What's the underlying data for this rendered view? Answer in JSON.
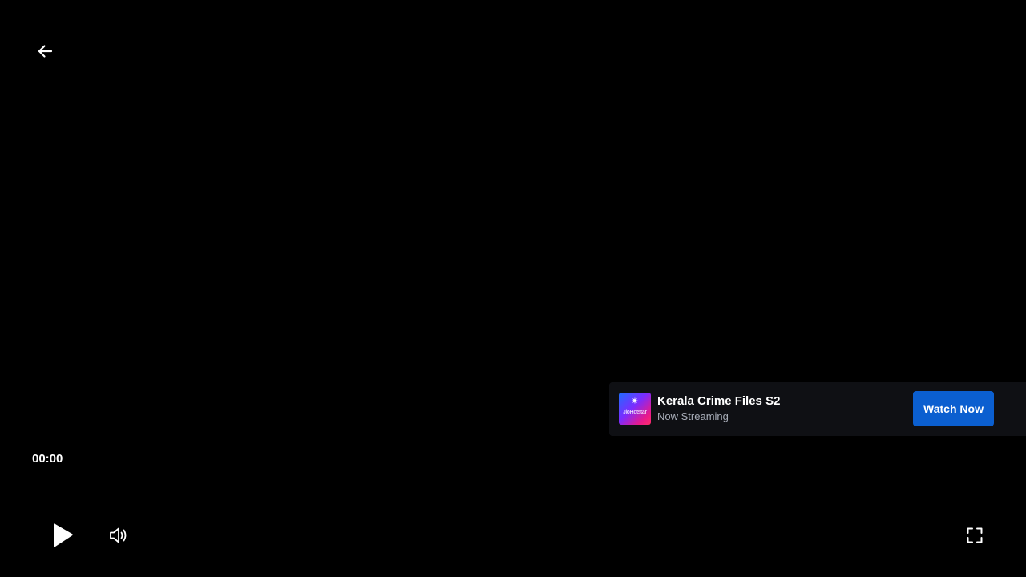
{
  "player": {
    "back_icon": "arrow-left-icon",
    "time_current": "00:00",
    "controls": {
      "play_icon": "play-icon",
      "volume_icon": "volume-icon",
      "fullscreen_icon": "fullscreen-icon"
    }
  },
  "ad": {
    "logo_brand": "JioHotstar",
    "logo_icon": "star-icon",
    "title": "Kerala Crime Files S2",
    "subtitle": "Now Streaming",
    "cta_label": "Watch Now"
  },
  "colors": {
    "background": "#000000",
    "ad_card_bg": "#0f1014",
    "cta_blue": "#0b5fd0",
    "subtitle_gray": "#a8adb8"
  }
}
